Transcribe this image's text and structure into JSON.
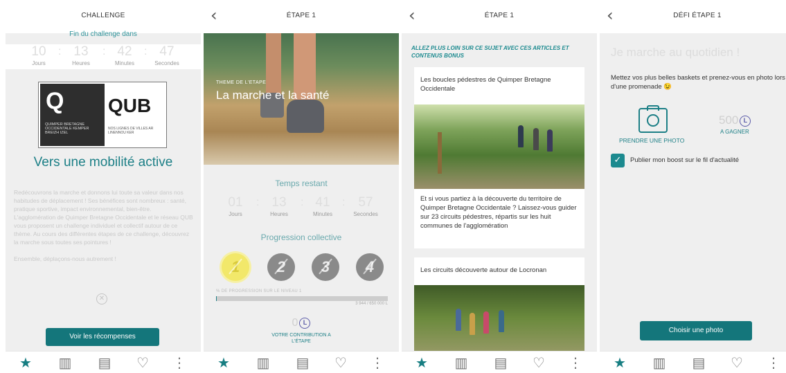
{
  "screen1": {
    "title": "CHALLENGE",
    "subtitle": "Fin du challenge dans",
    "countdown": [
      {
        "value": "10",
        "label": "Jours"
      },
      {
        "value": "13",
        "label": "Heures"
      },
      {
        "value": "42",
        "label": "Minutes"
      },
      {
        "value": "47",
        "label": "Secondes"
      }
    ],
    "logo": {
      "q": "Q",
      "org_lines": "QUIMPER BRETAGNE OCCIDENTALE KEMPER BREIZH IZEL",
      "qub": "QUB",
      "qub_small": "NOS LIGNES DE VILLES AR LINENNOU KER"
    },
    "headline": "Vers une mobilité active",
    "paragraph": "Redécouvrons la marche et donnons lui toute sa valeur dans nos habitudes de déplacement ! Ses bénéfices sont nombreux : santé, pratique sportive, impact environnemental, bien-être. L'agglomération de Quimper Bretagne Occidentale et le réseau QUB vous proposent un challenge individuel et collectif autour de ce thème. Au cours des différentes étapes de ce challenge, découvrez la marche sous toutes ses pointures !",
    "paragraph2": "Ensemble, déplaçons-nous autrement !",
    "button": "Voir les récompenses"
  },
  "screen2": {
    "title": "ÉTAPE 1",
    "theme_label": "THEME DE L'ETAPE",
    "hero_title": "La marche et la santé",
    "remaining": "Temps restant",
    "countdown": [
      {
        "value": "01",
        "label": "Jours"
      },
      {
        "value": "13",
        "label": "Heures"
      },
      {
        "value": "41",
        "label": "Minutes"
      },
      {
        "value": "57",
        "label": "Secondes"
      }
    ],
    "progression": "Progression collective",
    "levels": [
      "1",
      "2",
      "3",
      "4"
    ],
    "progress_label": "% DE PROGRESSION SUR LE NIVEAU 1",
    "progress_fraction": 0.006,
    "progress_value": "3 944 / 650 000",
    "contribution_value": "0",
    "contribution_label": "VOTRE CONTRIBUTION A L'ÉTAPE"
  },
  "screen3": {
    "title": "ÉTAPE 1",
    "bonus_heading": "ALLEZ PLUS LOIN SUR CE SUJET AVEC CES ARTICLES ET CONTENUS BONUS",
    "card1_title": "Les boucles pédestres de Quimper Bretagne Occidentale",
    "card1_body": "Et si vous partiez à la découverte du territoire de Quimper Bretagne Occidentale ? Laissez-vous guider sur 23 circuits pédestres, répartis sur les huit communes de l'agglomération",
    "card2_title": "Les circuits découverte autour de Locronan"
  },
  "screen4": {
    "title": "DÉFI ÉTAPE 1",
    "challenge_title": "Je marche au quotidien !",
    "description": "Mettez vos plus belles baskets et prenez-vous en photo lors d'une promenade 😉",
    "take_photo": "PRENDRE UNE PHOTO",
    "points": "500",
    "to_win": "A GAGNER",
    "publish_label": "Publier mon boost sur le fil d'actualité",
    "button": "Choisir une photo"
  },
  "common": {
    "back_glyph": "‹",
    "coin_letter": "L",
    "check_glyph": "✓",
    "close_glyph": "✕",
    "separator": ":"
  },
  "tabbar_icons": [
    "star-icon",
    "buildings-icon",
    "newspaper-icon",
    "heart-pulse-icon",
    "more-icon"
  ],
  "colors": {
    "accent": "#1c7f86",
    "button": "#14767b",
    "coin": "#5a5aa8",
    "level_active": "#f2e86a"
  }
}
